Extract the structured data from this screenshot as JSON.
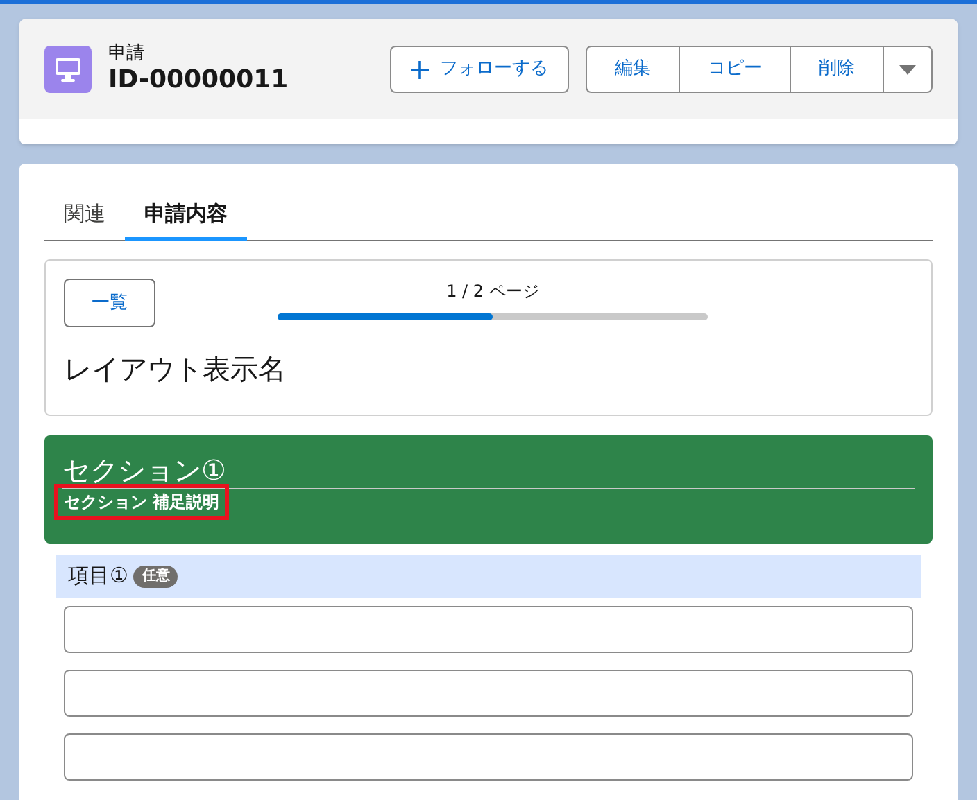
{
  "header": {
    "object_type": "申請",
    "record_name": "ID-00000011",
    "follow_button": "フォローする",
    "actions": [
      "編集",
      "コピー",
      "削除"
    ]
  },
  "tabs": [
    {
      "label": "関連",
      "selected": false
    },
    {
      "label": "申請内容",
      "selected": true
    }
  ],
  "progress": {
    "list_button": "一覧",
    "page_label": "1 / 2 ページ",
    "level": 0.5,
    "layout_name": "レイアウト表示名"
  },
  "section": {
    "title": "セクション①",
    "description": "セクション 補足説明",
    "highlighted": true
  },
  "field": {
    "label": "項目①",
    "badge": "任意",
    "inputs": [
      {
        "kind": "text"
      },
      {
        "kind": "text"
      },
      {
        "kind": "text"
      }
    ]
  }
}
